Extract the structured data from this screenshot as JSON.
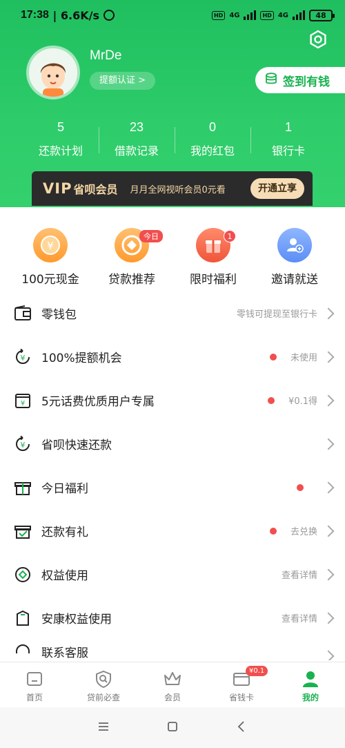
{
  "status_bar": {
    "time": "17:38",
    "speed": "6.6K/s",
    "net1": "4G",
    "net2": "4G",
    "battery": "48"
  },
  "profile": {
    "username": "MrDe",
    "cert_label": "提额认证 >",
    "sign_label": "签到有钱"
  },
  "stats": [
    {
      "value": "5",
      "label": "还款计划"
    },
    {
      "value": "23",
      "label": "借款记录"
    },
    {
      "value": "0",
      "label": "我的红包"
    },
    {
      "value": "1",
      "label": "银行卡"
    }
  ],
  "vip": {
    "logo": "VIP",
    "name": "省呗会员",
    "desc": "月月全网视听会员0元看",
    "button": "开通立享"
  },
  "features": [
    {
      "label": "100元现金",
      "icon": "yuan-coin-icon"
    },
    {
      "label": "贷款推荐",
      "icon": "coin-diamond-icon",
      "tag": "今日"
    },
    {
      "label": "限时福利",
      "icon": "gift-box-icon",
      "tag": "1"
    },
    {
      "label": "邀请就送",
      "icon": "add-user-icon"
    }
  ],
  "list": [
    {
      "title": "零钱包",
      "right": "零钱可提现至银行卡",
      "dot": false,
      "icon": "wallet-icon"
    },
    {
      "title": "100%提额机会",
      "right": "未使用",
      "dot": true,
      "icon": "yuan-cycle-icon"
    },
    {
      "title": "5元话费优质用户专属",
      "right": "¥0.1得",
      "dot": true,
      "icon": "yuan-card-icon"
    },
    {
      "title": "省呗快速还款",
      "right": "",
      "dot": false,
      "icon": "yuan-cycle-icon"
    },
    {
      "title": "今日福利",
      "right": "",
      "dot": true,
      "icon": "gift-icon"
    },
    {
      "title": "还款有礼",
      "right": "去兑换",
      "dot": true,
      "icon": "gift-check-icon"
    },
    {
      "title": "权益使用",
      "right": "查看详情",
      "dot": false,
      "icon": "diamond-circle-icon"
    },
    {
      "title": "安康权益使用",
      "right": "查看详情",
      "dot": false,
      "icon": "bag-icon"
    },
    {
      "title": "联系客服",
      "right": "",
      "dot": false,
      "icon": "headset-icon"
    }
  ],
  "bottom_nav": [
    {
      "label": "首页",
      "icon": "home-icon",
      "active": false
    },
    {
      "label": "贷前必查",
      "icon": "shield-search-icon",
      "active": false
    },
    {
      "label": "会员",
      "icon": "crown-icon",
      "active": false
    },
    {
      "label": "省钱卡",
      "icon": "card-icon",
      "active": false,
      "badge": "¥0.1"
    },
    {
      "label": "我的",
      "icon": "user-icon",
      "active": true
    }
  ],
  "colors": {
    "brand_green": "#1fbf5f",
    "badge_red": "#f24e4e",
    "vip_gold": "#f5d7a6"
  }
}
